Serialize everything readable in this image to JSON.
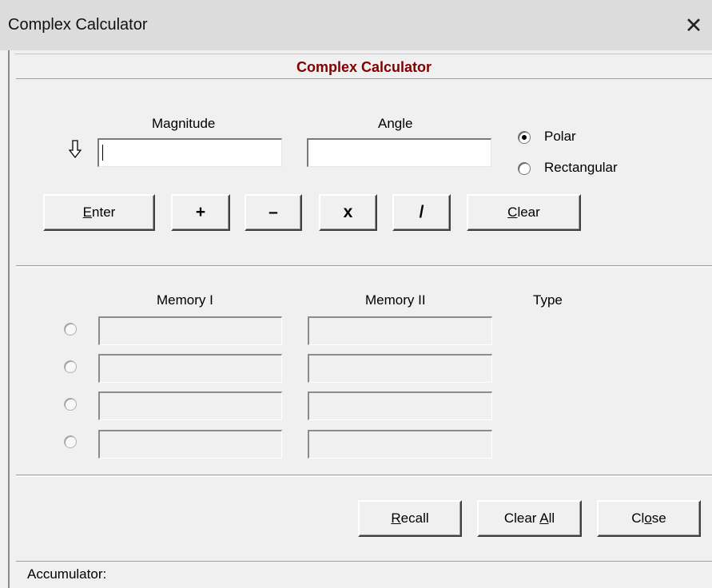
{
  "window": {
    "title": "Complex Calculator",
    "close_glyph": "✕"
  },
  "header": {
    "title": "Complex Calculator"
  },
  "input": {
    "magnitude_label": "Magnitude",
    "angle_label": "Angle",
    "magnitude_value": "",
    "angle_value": "",
    "entry_arrow_icon": "down-arrow-icon",
    "mode_options": [
      {
        "label": "Polar",
        "selected": true
      },
      {
        "label": "Rectangular",
        "selected": false
      }
    ]
  },
  "operations": {
    "enter_label": "Enter",
    "enter_accel": "E",
    "add_label": "+",
    "subtract_label": "–",
    "multiply_label": "x",
    "divide_label": "/",
    "clear_label": "Clear",
    "clear_accel": "C"
  },
  "memory": {
    "col1_header": "Memory I",
    "col2_header": "Memory II",
    "col3_header": "Type",
    "rows": [
      {
        "mem1": "",
        "mem2": "",
        "type": ""
      },
      {
        "mem1": "",
        "mem2": "",
        "type": ""
      },
      {
        "mem1": "",
        "mem2": "",
        "type": ""
      },
      {
        "mem1": "",
        "mem2": "",
        "type": ""
      }
    ]
  },
  "actions": {
    "recall_label": "Recall",
    "recall_accel": "R",
    "clear_all_label": "Clear All",
    "clear_all_accel": "A",
    "close_label": "Close",
    "close_accel": "o"
  },
  "status": {
    "accumulator_label": "Accumulator:"
  },
  "colors": {
    "header_text": "#800000",
    "titlebar": "#dcdcdc",
    "dialog_bg": "#f0f0f0"
  }
}
